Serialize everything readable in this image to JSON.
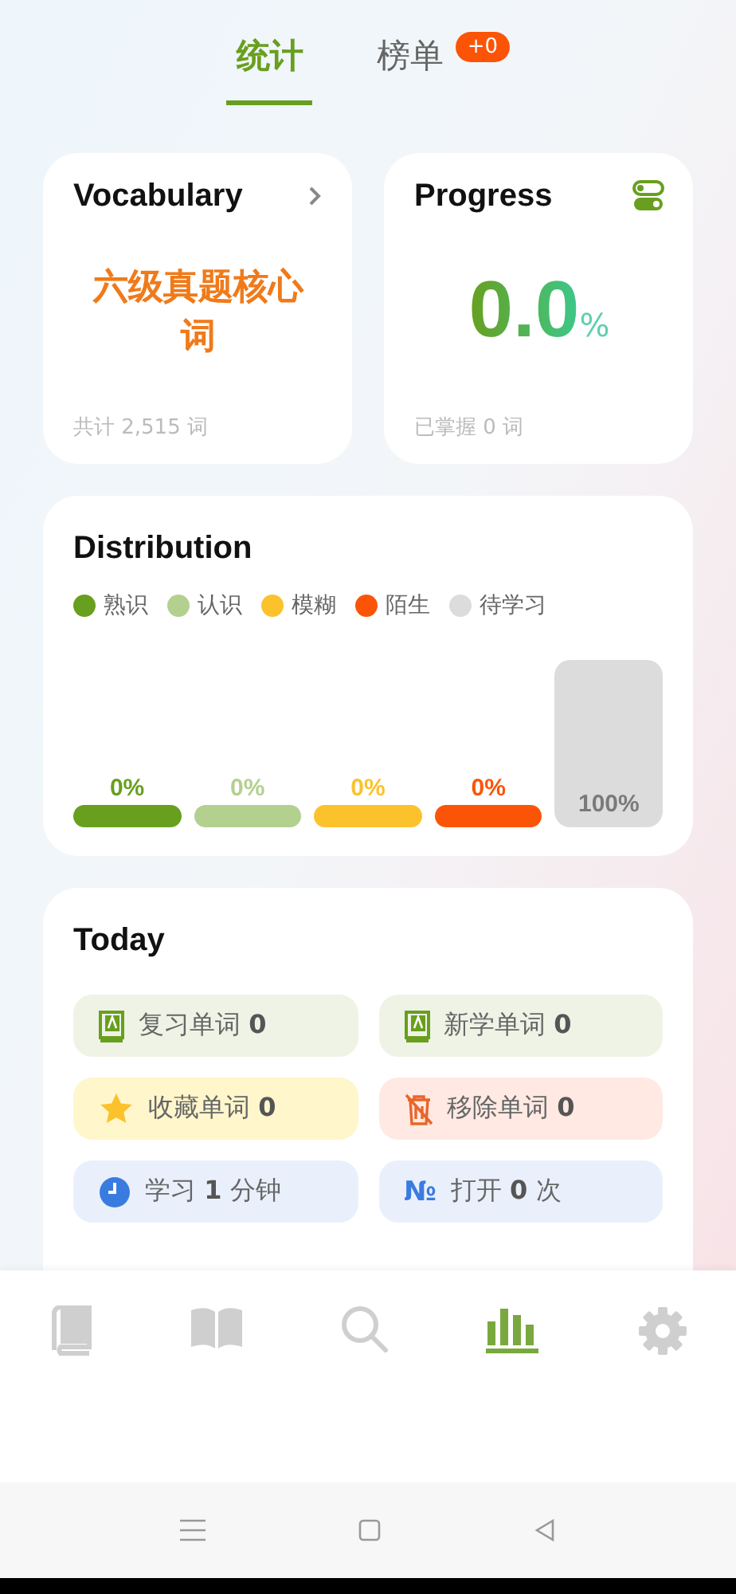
{
  "tabs": [
    {
      "label": "统计",
      "selected": true
    },
    {
      "label": "榜单",
      "selected": false,
      "badge": "+0"
    }
  ],
  "vocabulary": {
    "title": "Vocabulary",
    "book": "六级真题核心词",
    "total": "共计 2,515 词"
  },
  "progress": {
    "title": "Progress",
    "value": "0.0",
    "unit": "%",
    "mastered": "已掌握 0 词"
  },
  "distribution": {
    "title": "Distribution",
    "legend": [
      {
        "label": "熟识",
        "color": "#689f1e"
      },
      {
        "label": "认识",
        "color": "#b3d08f"
      },
      {
        "label": "模糊",
        "color": "#fbc22c"
      },
      {
        "label": "陌生",
        "color": "#fc5407"
      },
      {
        "label": "待学习",
        "color": "#dcdcdc"
      }
    ],
    "bars": [
      {
        "label": "0%",
        "full": false
      },
      {
        "label": "0%",
        "full": false
      },
      {
        "label": "0%",
        "full": false
      },
      {
        "label": "0%",
        "full": false
      },
      {
        "label": "100%",
        "full": true
      }
    ]
  },
  "today": {
    "title": "Today",
    "items": [
      {
        "kind": "review",
        "text": "复习单词 **0**"
      },
      {
        "kind": "new",
        "text": "新学单词 **0**"
      },
      {
        "kind": "star",
        "text": "收藏单词 **0**"
      },
      {
        "kind": "removed",
        "text": "移除单词 **0**"
      },
      {
        "kind": "time",
        "text": "学习 **1** 分钟"
      },
      {
        "kind": "opens",
        "symbol": "№",
        "text": "打开 **0** 次"
      }
    ]
  },
  "bottom_nav": [
    {
      "selected": false
    },
    {
      "selected": false
    },
    {
      "selected": false
    },
    {
      "selected": true
    },
    {
      "selected": false
    }
  ]
}
